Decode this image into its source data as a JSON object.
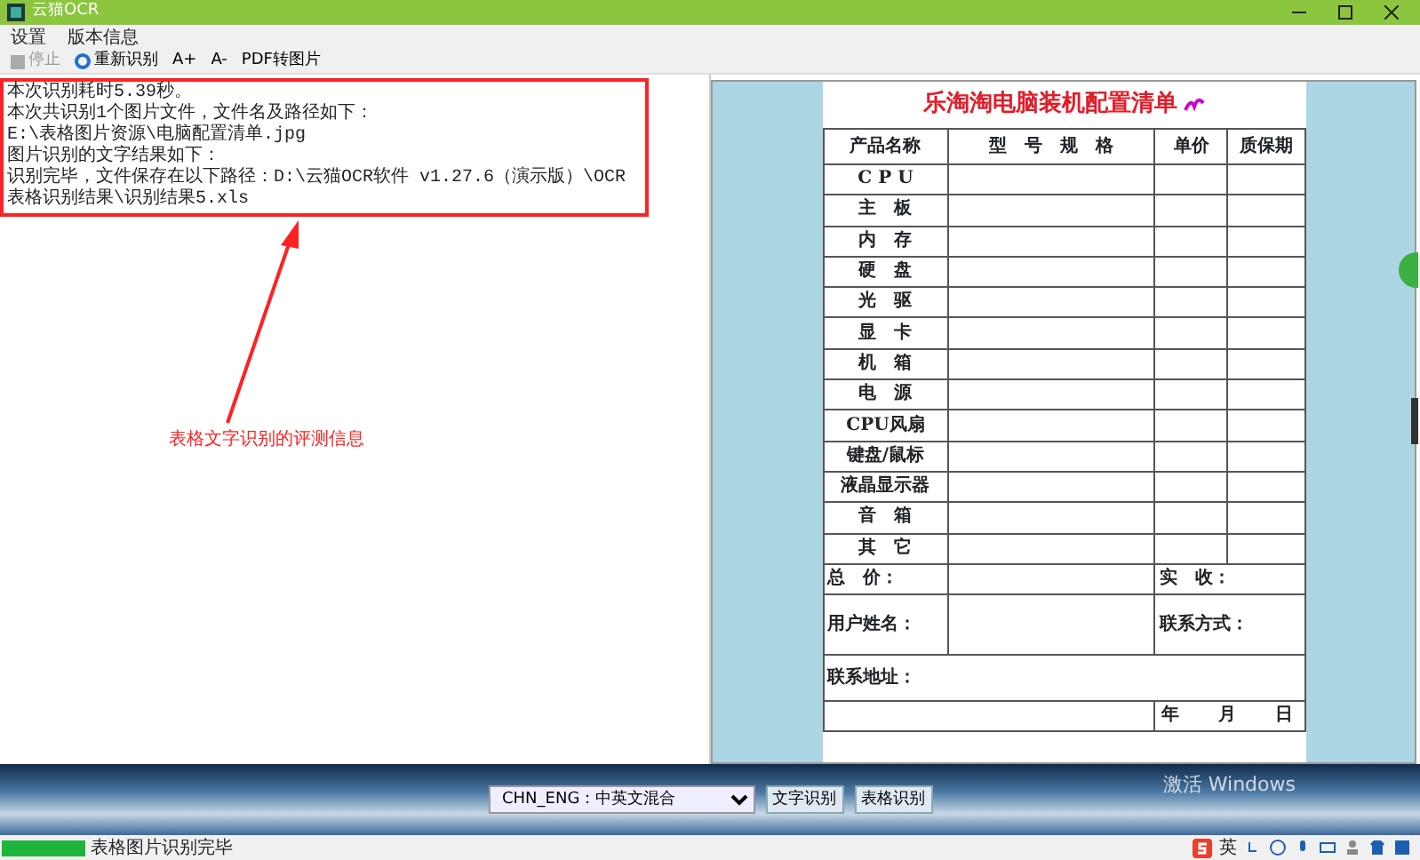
{
  "window": {
    "title": "云猫OCR"
  },
  "menu": [
    "设置",
    "版本信息"
  ],
  "toolbar": [
    {
      "label": "停止",
      "kind": "stop",
      "disabled": true
    },
    {
      "label": "重新识别",
      "kind": "refresh",
      "disabled": false
    },
    {
      "label": "A+",
      "kind": "text",
      "disabled": false
    },
    {
      "label": "A-",
      "kind": "text",
      "disabled": false
    },
    {
      "label": "PDF转图片",
      "kind": "text",
      "disabled": false
    }
  ],
  "log": {
    "lines": [
      "本次识别耗时5.39秒。",
      "本次共识别1个图片文件，文件名及路径如下：",
      "E:\\表格图片资源\\电脑配置清单.jpg",
      "图片识别的文字结果如下：",
      "识别完毕，文件保存在以下路径：D:\\云猫OCR软件 v1.27.6（演示版）\\OCR表格识别结果\\识别结果5.xls"
    ]
  },
  "annotation": {
    "caption": "表格文字识别的评测信息"
  },
  "document": {
    "title": "乐淘淘电脑装机配置清单",
    "headers": [
      "产品名称",
      "型　号　规　格",
      "单价",
      "质保期"
    ],
    "items": [
      "C P U",
      "主　板",
      "内　存",
      "硬　盘",
      "光　驱",
      "显　卡",
      "机　箱",
      "电　源",
      "CPU风扇",
      "键盘/鼠标",
      "液晶显示器",
      "音　箱",
      "其　它"
    ],
    "total": "总　价：",
    "received": "实　收：",
    "customer": "用户姓名：",
    "contact": "联系方式：",
    "address": "联系地址：",
    "date": [
      "年",
      "月",
      "日"
    ]
  },
  "bottom": {
    "language": "CHN_ENG：中英文混合",
    "buttons": [
      "文字识别",
      "表格识别"
    ],
    "overlay": "激活 Windows"
  },
  "status": {
    "level": 1,
    "text": "表格图片识别完毕",
    "ime": "英"
  }
}
